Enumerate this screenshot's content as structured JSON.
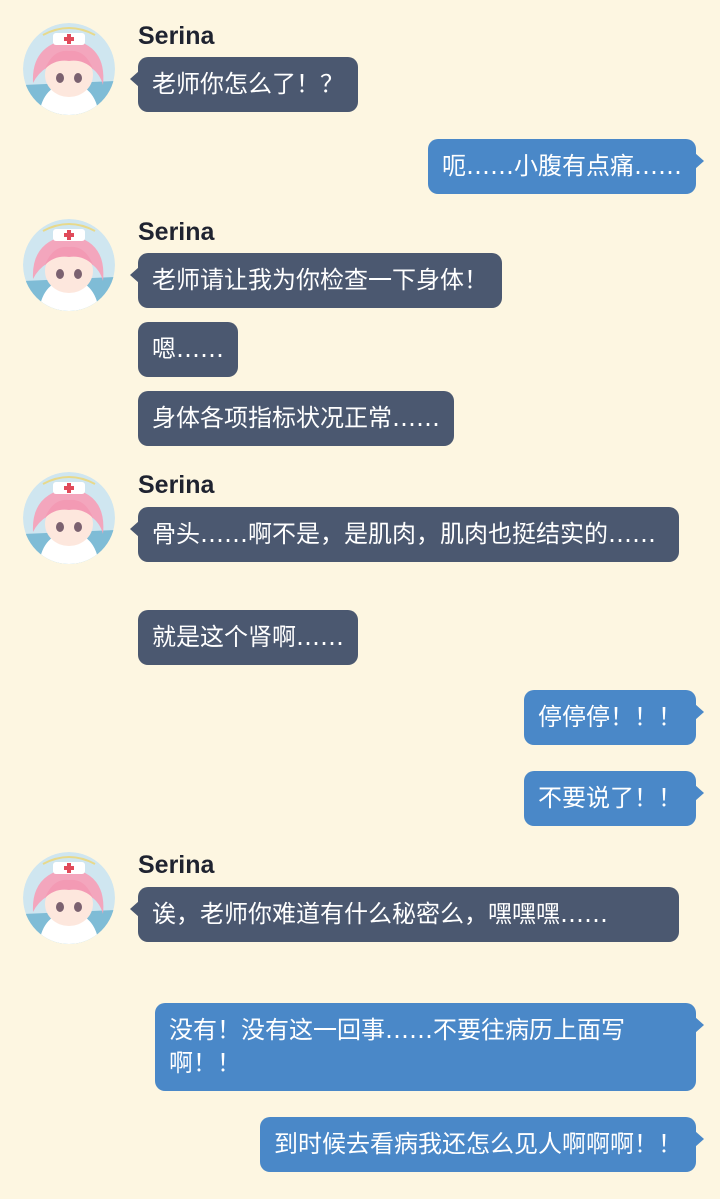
{
  "chat": {
    "character_name": "Serina",
    "avatar_icon": "nurse-avatar-icon",
    "colors": {
      "background": "#fdf6e1",
      "left_bubble": "#4b5870",
      "right_bubble": "#4a88c8",
      "text": "#ffffff"
    },
    "messages": [
      {
        "from": "Serina",
        "text": "老师你怎么了！？"
      },
      {
        "from": "sensei",
        "text": "呃……小腹有点痛……"
      },
      {
        "from": "Serina",
        "text": "老师请让我为你检查一下身体！"
      },
      {
        "from": "Serina",
        "text": "嗯……"
      },
      {
        "from": "Serina",
        "text": "身体各项指标状况正常……"
      },
      {
        "from": "Serina",
        "text": "骨头……啊不是，是肌肉，肌肉也挺结实的……"
      },
      {
        "from": "Serina",
        "text": "就是这个肾啊……"
      },
      {
        "from": "sensei",
        "text": "停停停！！！"
      },
      {
        "from": "sensei",
        "text": "不要说了！！"
      },
      {
        "from": "Serina",
        "text": "诶，老师你难道有什么秘密么，嘿嘿嘿……"
      },
      {
        "from": "sensei",
        "text": "没有！没有这一回事……不要往病历上面写啊！！"
      },
      {
        "from": "sensei",
        "text": "到时候去看病我还怎么见人啊啊啊！！"
      }
    ]
  }
}
